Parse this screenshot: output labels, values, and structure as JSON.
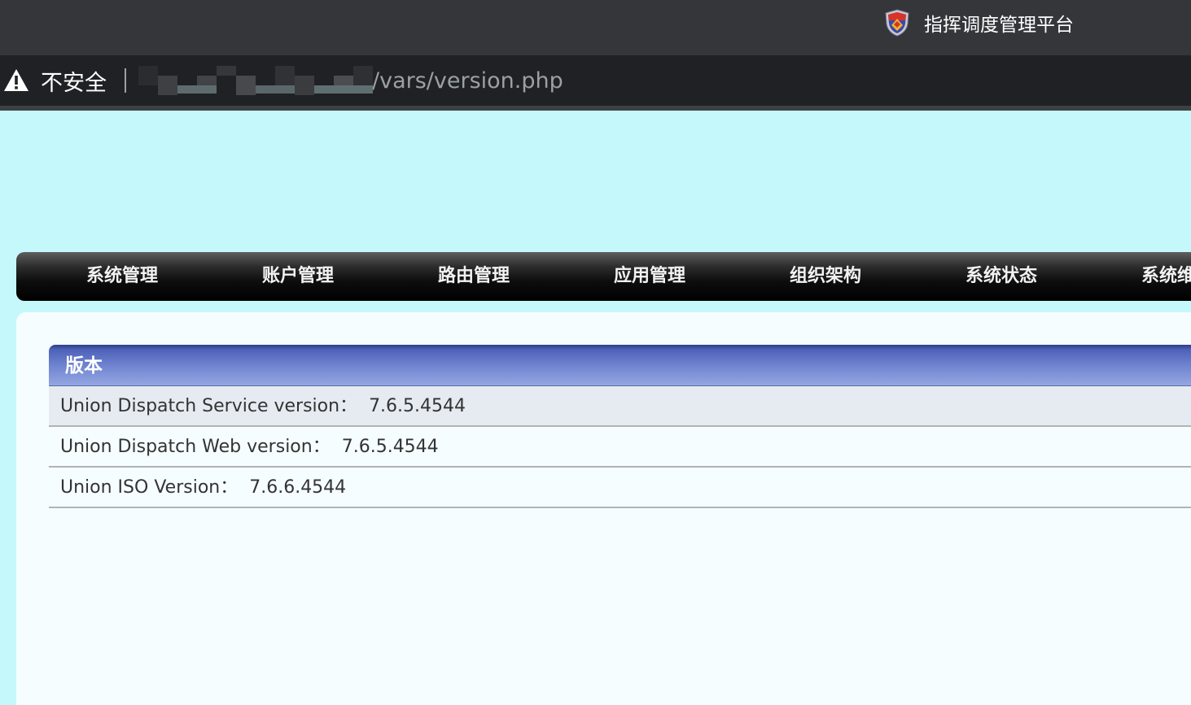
{
  "browser": {
    "tab_title": "指挥调度管理平台",
    "favicon": "shield-logo-icon",
    "security_label": "不安全",
    "url_path": "/vars/version.php",
    "warning_icon": "warning-triangle-icon"
  },
  "nav": {
    "items": [
      {
        "label": "系统管理"
      },
      {
        "label": "账户管理"
      },
      {
        "label": "路由管理"
      },
      {
        "label": "应用管理"
      },
      {
        "label": "组织架构"
      },
      {
        "label": "系统状态"
      },
      {
        "label": "系统维"
      }
    ]
  },
  "version_panel": {
    "title": "版本",
    "rows": [
      {
        "label": "Union Dispatch Service version：",
        "value": "7.6.5.4544"
      },
      {
        "label": "Union Dispatch Web version：",
        "value": "7.6.5.4544"
      },
      {
        "label": "Union ISO Version：",
        "value": "7.6.6.4544"
      }
    ]
  },
  "colors": {
    "page_bg": "#c5f8fb",
    "tabstrip_bg": "#35363a",
    "addressbar_bg": "#202124",
    "header_blue": "#4e62b8"
  }
}
